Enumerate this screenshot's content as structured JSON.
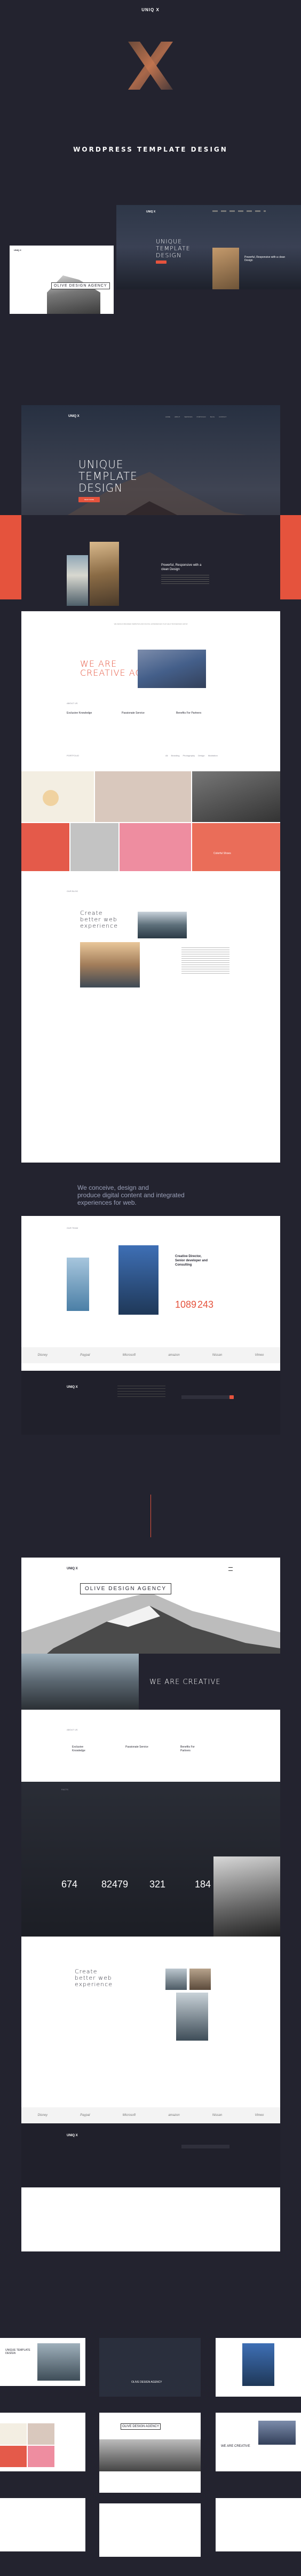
{
  "colors": {
    "bg": "#23232f",
    "accent": "#e5533d",
    "white": "#ffffff",
    "dark": "#2a2a35"
  },
  "top": {
    "logo": "UNIQ X",
    "tagline": "WORDPRESS TEMPLATE DESIGN"
  },
  "preview1": {
    "logo": "UNIQ X",
    "hero_title": "UNIQUE TEMPLATE DESIGN",
    "card_title": "OLIVE DESIGN AGENCY",
    "side_title": "Powerful, Responsive with a clean Design"
  },
  "page1": {
    "logo": "UNIQ X",
    "nav": [
      "HOME",
      "ABOUT",
      "SERVICES",
      "PORTFOLIO",
      "BLOG",
      "CONTACT"
    ],
    "hero_title_1": "UNIQUE",
    "hero_title_2": "TEMPLATE",
    "hero_title_3": "DESIGN",
    "hero_button": "READ MORE",
    "feature_title": "Powerful, Responsive with a clean Design",
    "strip_text": "WE DESIGN BRANDED WEBSITES AND DIGITAL EXPERIENCES THAT HELP BUSINESSES GROW",
    "creative_1": "WE ARE",
    "creative_2": "CREATIVE AGENCY",
    "services_label": "ABOUT US",
    "services": [
      {
        "title": "Exclusive Knowledge"
      },
      {
        "title": "Passionate Service"
      },
      {
        "title": "Benefits For Partners"
      }
    ],
    "portfolio_label": "PORTFOLIO",
    "portfolio_filters": [
      "All",
      "Branding",
      "Photography",
      "Design",
      "Illustration"
    ],
    "portfolio_tile_title": "Colorful Shoes",
    "blog_label": "OUR BLOG",
    "create_title_1": "Create",
    "create_title_2": "better web",
    "create_title_3": "experience",
    "conceive_1": "We conceive, design and",
    "conceive_2": "produce digital content and integrated",
    "conceive_3": "experiences for web.",
    "team_label": "OUR TEAM",
    "team_title_1": "Creative Director,",
    "team_title_2": "Senior developer and",
    "team_title_3": "Consulting",
    "stat_1": "1089",
    "stat_2": "243",
    "clients": [
      "Disney",
      "Paypal",
      "Microsoft",
      "amazon",
      "Nissan",
      "Vimeo"
    ],
    "footer_logo": "UNIQ X"
  },
  "page2": {
    "logo": "UNIQ X",
    "hero_card": "OLIVE DESIGN AGENCY",
    "we_are": "WE ARE CREATIVE",
    "services_label": "ABOUT US",
    "services": [
      {
        "title": "Exclusive Knowledge"
      },
      {
        "title": "Passionate Service"
      },
      {
        "title": "Benefits For Partners"
      }
    ],
    "facts_label": "FACTS",
    "stats": [
      {
        "value": "674"
      },
      {
        "value": "82479"
      },
      {
        "value": "321"
      },
      {
        "value": "184"
      }
    ],
    "create_title_1": "Create",
    "create_title_2": "better web",
    "create_title_3": "experience",
    "clients": [
      "Disney",
      "Paypal",
      "Microsoft",
      "amazon",
      "Nissan",
      "Vimeo"
    ],
    "footer_logo": "UNIQ X"
  },
  "thumbs": {
    "t1": "UNIQUE TEMPLATE DESIGN",
    "t2": "OLIVE DESIGN AGENCY",
    "t3": "WE ARE CREATIVE"
  }
}
